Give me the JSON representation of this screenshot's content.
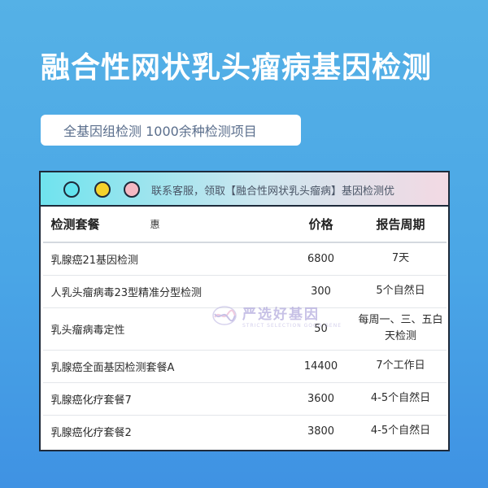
{
  "header": {
    "title": "融合性网状乳头瘤病基因检测",
    "subtitle": "全基因组检测 1000余种检测项目"
  },
  "window": {
    "notice": "联系客服，领取【融合性网状乳头瘤病】基因检测优",
    "dots": [
      "#62e4ef",
      "#f4d22b",
      "#f5b8c3"
    ]
  },
  "table": {
    "columns": [
      "检测套餐",
      "价格",
      "报告周期"
    ],
    "header_note": "惠",
    "rows": [
      {
        "name": "乳腺癌21基因检测",
        "price": "6800",
        "cycle": "7天"
      },
      {
        "name": "人乳头瘤病毒23型精准分型检测",
        "price": "300",
        "cycle": "5个自然日"
      },
      {
        "name": "乳头瘤病毒定性",
        "price": "50",
        "cycle": "每周一、三、五白天检测"
      },
      {
        "name": "乳腺癌全面基因检测套餐A",
        "price": "14400",
        "cycle": "7个工作日"
      },
      {
        "name": "乳腺癌化疗套餐7",
        "price": "3600",
        "cycle": "4-5个自然日"
      },
      {
        "name": "乳腺癌化疗套餐2",
        "price": "3800",
        "cycle": "4-5个自然日"
      }
    ]
  },
  "watermark": {
    "text": "严选好基因",
    "subtext": "STRICT SELECTION GOOD GENE",
    "icon": "dna-logo-icon"
  }
}
